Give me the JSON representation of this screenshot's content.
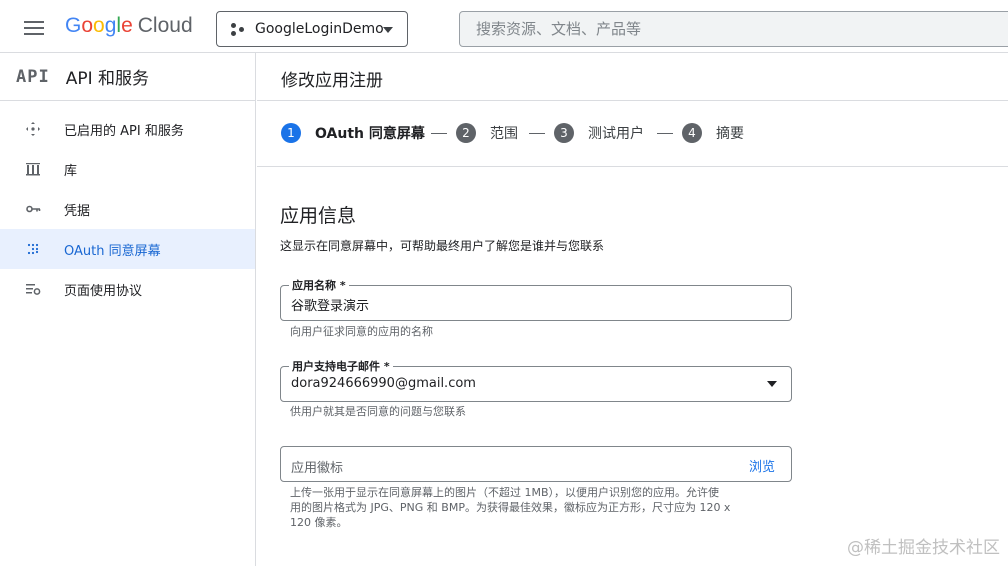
{
  "header": {
    "logo_letters": [
      "G",
      "o",
      "o",
      "g",
      "l",
      "e"
    ],
    "logo_suffix": "Cloud",
    "project_name": "GoogleLoginDemo",
    "search_placeholder": "搜索资源、文档、产品等"
  },
  "sidebar": {
    "logo": "API",
    "title": "API 和服务",
    "items": [
      {
        "label": "已启用的 API 和服务",
        "icon": "diamond-arrows-icon"
      },
      {
        "label": "库",
        "icon": "library-icon"
      },
      {
        "label": "凭据",
        "icon": "key-icon"
      },
      {
        "label": "OAuth 同意屏幕",
        "icon": "dots-grid-icon",
        "active": true
      },
      {
        "label": "页面使用协议",
        "icon": "settings-list-icon"
      }
    ]
  },
  "main": {
    "title": "修改应用注册",
    "steps": [
      {
        "num": "1",
        "label": "OAuth 同意屏幕",
        "active": true
      },
      {
        "num": "2",
        "label": "范围"
      },
      {
        "num": "3",
        "label": "测试用户"
      },
      {
        "num": "4",
        "label": "摘要"
      }
    ],
    "section_title": "应用信息",
    "section_desc": "这显示在同意屏幕中，可帮助最终用户了解您是谁并与您联系",
    "app_name": {
      "label": "应用名称 *",
      "value": "谷歌登录演示",
      "hint": "向用户征求同意的应用的名称"
    },
    "support_email": {
      "label": "用户支持电子邮件 *",
      "value": "dora924666990@gmail.com",
      "hint": "供用户就其是否同意的问题与您联系"
    },
    "app_logo": {
      "placeholder": "应用徽标",
      "browse": "浏览",
      "hint_line1": "上传一张用于显示在同意屏幕上的图片（不超过 1MB），以便用户识别您的应用。允许使",
      "hint_line2": "用的图片格式为 JPG、PNG 和 BMP。为获得最佳效果，徽标应为正方形，尺寸应为 120 x",
      "hint_line3": "120 像素。"
    }
  },
  "watermark": "@稀土掘金技术社区",
  "colors": {
    "accent": "#1a73e8",
    "active_bg": "#e8f0fe",
    "border": "#dadce0"
  }
}
